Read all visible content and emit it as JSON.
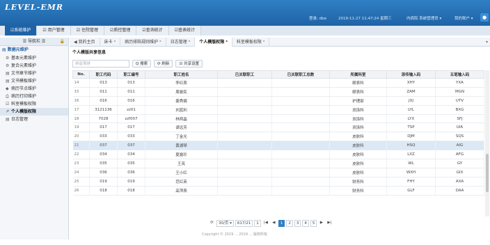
{
  "app": {
    "logo": "LEVEL-EMR"
  },
  "header": {
    "login": "登录: dbe",
    "datetime": "2019-11-27 11:47:24 星期三",
    "dept": "内病院 系统管理员 ▾",
    "account": "我的账户 ▾",
    "notify_icon": "bell-icon"
  },
  "module_tabs": [
    {
      "label": "☑系统维护"
    },
    {
      "label": "☑ 用户管理"
    },
    {
      "label": "☑ 住院管理"
    },
    {
      "label": "☑质控管理"
    },
    {
      "label": "☑查询统计"
    },
    {
      "label": "☑查表统计"
    }
  ],
  "sidebar": {
    "header": "☰ 导航栏 ☰",
    "lock": "🔒",
    "group": "▤ 数据元维护",
    "items": [
      {
        "icon": "⚙",
        "label": "基本元素维护"
      },
      {
        "icon": "⚙",
        "label": "复合元素维护"
      },
      {
        "icon": "▤",
        "label": "文书章节维护"
      },
      {
        "icon": "▤",
        "label": "文书模板维护"
      },
      {
        "icon": "◆",
        "label": "病历节点维护"
      },
      {
        "icon": "⎙",
        "label": "病历打印维护"
      },
      {
        "icon": "☑",
        "label": "科室模板权限"
      },
      {
        "icon": "↗",
        "label": "个人模版权限"
      },
      {
        "icon": "▤",
        "label": "日志管理"
      }
    ]
  },
  "page_tabs": [
    {
      "label": "◀ 我的主页"
    },
    {
      "label": "床卡 ˣ"
    },
    {
      "label": "病历排陷规则维护 ˣ"
    },
    {
      "label": "日志管理 ˣ"
    },
    {
      "label": "个人模版权限 ˣ"
    },
    {
      "label": "科室模板权限 ˣ"
    }
  ],
  "page_tabs_more": "▾",
  "panel_title": "个人模版共享信息",
  "toolbar": {
    "search_placeholder": "拼音首拼",
    "search_label": "Q 搜索",
    "refresh_label": "⟳ 刷新",
    "share_label": "☑ 共享设置"
  },
  "table": {
    "columns": [
      "No.",
      "职工代码",
      "职工编号",
      "职工姓名",
      "已关联职工",
      "已关联职工总数",
      "所属科室",
      "添传输入码",
      "五笔输入码"
    ],
    "rows": [
      [
        "14",
        "013",
        "013",
        "李红燕",
        "",
        "",
        "眼表科",
        "XHY",
        "YXA"
      ],
      [
        "15",
        "011",
        "011",
        "周晏民",
        "",
        "",
        "眼表科",
        "ZAM",
        "MGN"
      ],
      [
        "16",
        "016",
        "016",
        "姜秀娟",
        "",
        "",
        "护理部",
        "JXJ",
        "UTV"
      ],
      [
        "17",
        "3121136",
        "zz01",
        "刘蓝利",
        "",
        "",
        "测涤科",
        "LYL",
        "BXG"
      ],
      [
        "18",
        "7028",
        "zzf007",
        "林两晶",
        "",
        "",
        "测涤科",
        "LYX",
        "SFJ"
      ],
      [
        "19",
        "017",
        "017",
        "谭远芳",
        "",
        "",
        "测涤科",
        "TSP",
        "UIA"
      ],
      [
        "20",
        "033",
        "033",
        "丁金光",
        "",
        "",
        "皮肤科",
        "DJM",
        "SQS"
      ],
      [
        "21",
        "037",
        "037",
        "黄湖琴",
        "",
        "",
        "皮肤科",
        "HSQ",
        "AIG"
      ],
      [
        "22",
        "034",
        "034",
        "夏露珍",
        "",
        "",
        "皮肤科",
        "LXZ",
        "AFG"
      ],
      [
        "23",
        "035",
        "035",
        "王亮",
        "",
        "",
        "皮肤科",
        "WL",
        "GY"
      ],
      [
        "24",
        "036",
        "036",
        "王小红",
        "",
        "",
        "皮肤科",
        "WXH",
        "GIX"
      ],
      [
        "25",
        "019",
        "019",
        "范红英",
        "",
        "",
        "财务科",
        "FHY",
        "AXA"
      ],
      [
        "26",
        "018",
        "018",
        "高萍燕",
        "",
        "",
        "财务科",
        "GLF",
        "DAA"
      ]
    ],
    "selected_row": 7
  },
  "pager": {
    "refresh": "⟳",
    "page_size": "30/页 ▾",
    "page_info": "617/21",
    "jump_value": "1",
    "first": "|◀",
    "prev": "◀",
    "pages": [
      "1",
      "2",
      "3",
      "4",
      "5"
    ],
    "current": "1",
    "next": "▶",
    "last": "▶|"
  },
  "footer": "Copyright © 2019 ... 2019 ... 版权所有"
}
